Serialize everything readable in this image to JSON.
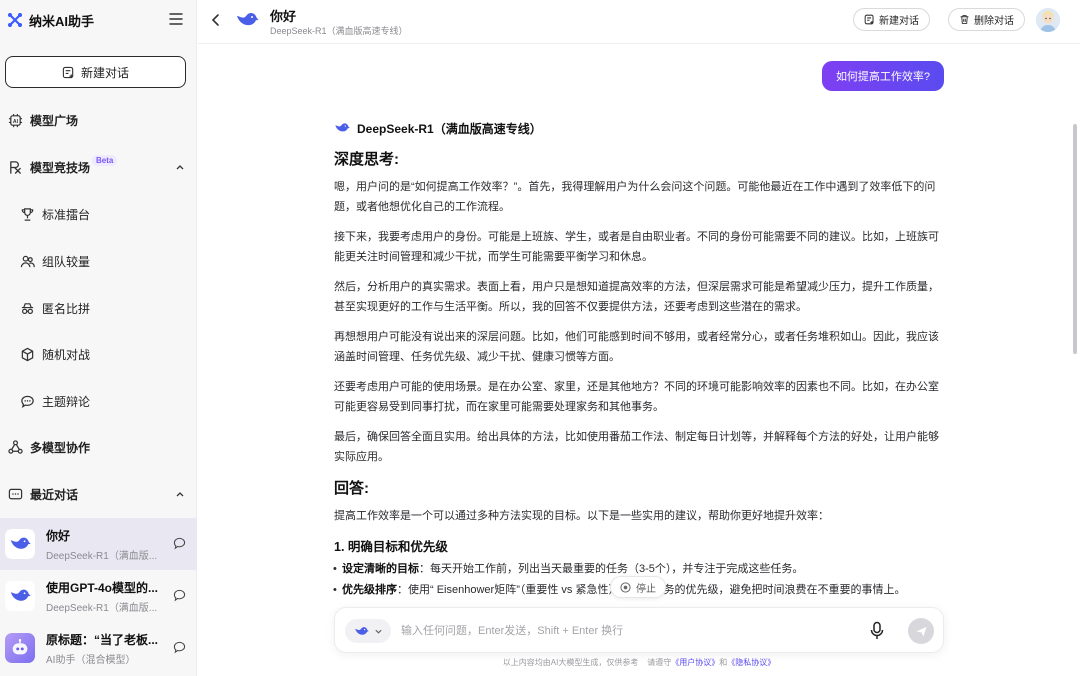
{
  "brand": {
    "name": "纳米AI助手"
  },
  "sidebar": {
    "new_chat_label": "新建对话",
    "nav": {
      "model_square": "模型广场",
      "arena": "模型竞技场",
      "arena_badge": "Beta",
      "arena_items": [
        "标准擂台",
        "组队较量",
        "匿名比拼",
        "随机对战",
        "主题辩论"
      ],
      "multi_model": "多模型协作",
      "recent": "最近对话"
    },
    "conversations": [
      {
        "title": "你好",
        "subtitle": "DeepSeek-R1（满血版..."
      },
      {
        "title": "使用GPT-4o模型的...",
        "subtitle": "DeepSeek-R1（满血版..."
      },
      {
        "title": "原标题：“当了老板...",
        "subtitle": "AI助手（混合模型）"
      }
    ]
  },
  "header": {
    "title": "你好",
    "subtitle": "DeepSeek-R1（满血版高速专线）",
    "new_chat_label": "新建对话",
    "delete_chat_label": "删除对话"
  },
  "chat": {
    "user_message": "如何提高工作效率?",
    "model_name": "DeepSeek-R1（满血版高速专线）",
    "think_heading": "深度思考:",
    "think_paragraphs": [
      "嗯，用户问的是“如何提高工作效率？”。首先，我得理解用户为什么会问这个问题。可能他最近在工作中遇到了效率低下的问题，或者他想优化自己的工作流程。",
      "接下来，我要考虑用户的身份。可能是上班族、学生，或者是自由职业者。不同的身份可能需要不同的建议。比如，上班族可能更关注时间管理和减少干扰，而学生可能需要平衡学习和休息。",
      "然后，分析用户的真实需求。表面上看，用户只是想知道提高效率的方法，但深层需求可能是希望减少压力，提升工作质量，甚至实现更好的工作与生活平衡。所以，我的回答不仅要提供方法，还要考虑到这些潜在的需求。",
      "再想想用户可能没有说出来的深层问题。比如，他们可能感到时间不够用，或者经常分心，或者任务堆积如山。因此，我应该涵盖时间管理、任务优先级、减少干扰、健康习惯等方面。",
      "还要考虑用户可能的使用场景。是在办公室、家里，还是其他地方？不同的环境可能影响效率的因素也不同。比如，在办公室可能更容易受到同事打扰，而在家里可能需要处理家务和其他事务。",
      "最后，确保回答全面且实用。给出具体的方法，比如使用番茄工作法、制定每日计划等，并解释每个方法的好处，让用户能够实际应用。"
    ],
    "answer_heading": "回答:",
    "answer_intro": "提高工作效率是一个可以通过多种方法实现的目标。以下是一些实用的建议，帮助你更好地提升效率：",
    "section1_heading": "1. 明确目标和优先级",
    "bullets": [
      {
        "bold": "设定清晰的目标",
        "text": "：每天开始工作前，列出当天最重要的任务（3-5个），并专注于完成这些任务。"
      },
      {
        "bold": "优先级排序",
        "text": "：使用“ Eisenhower矩阵”（重要性 vs 紧急性）来区分任务的优先级，避免把时间浪费在不重要的事情上。"
      }
    ],
    "stop_label": "停止"
  },
  "input": {
    "placeholder": "输入任何问题，Enter发送，Shift + Enter 换行",
    "value": ""
  },
  "footer": {
    "disclaimer": "以上内容均由AI大模型生成，仅供参考",
    "follow": "请遵守",
    "user_agreement": "《用户协议》",
    "and": "和",
    "privacy": "《隐私协议》"
  },
  "colors": {
    "accent": "#5a4bf0",
    "user_bubble_start": "#7e3ff2",
    "whale_blue": "#4a5ee8"
  }
}
